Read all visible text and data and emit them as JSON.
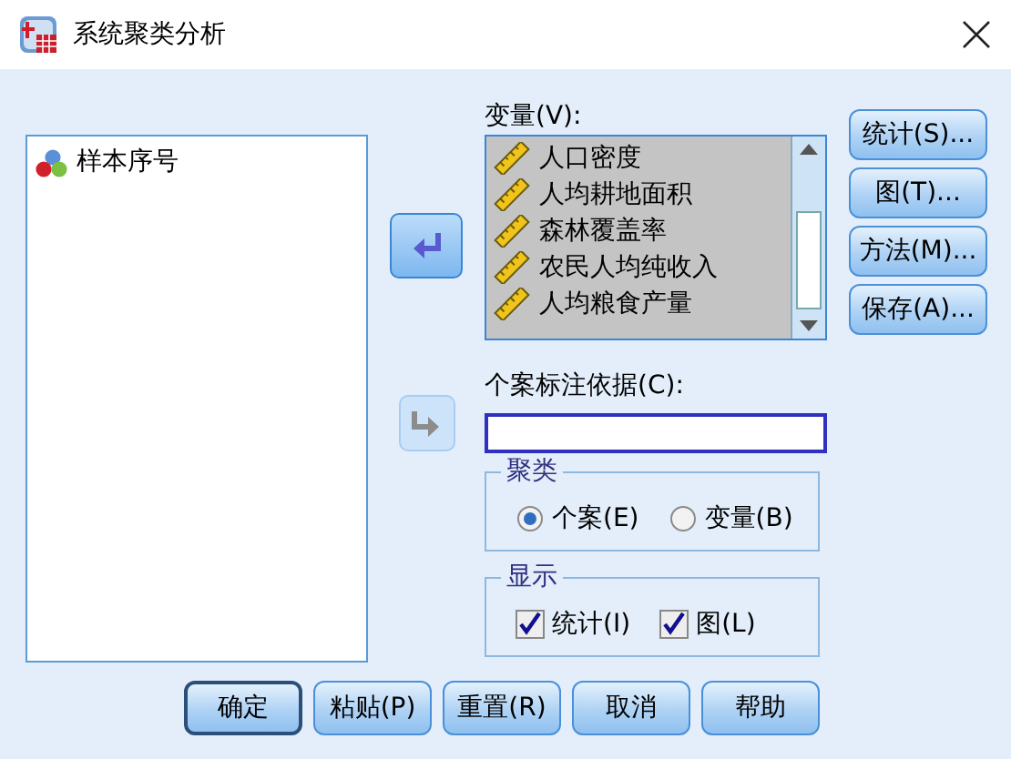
{
  "window": {
    "title": "系统聚类分析"
  },
  "source_list": {
    "items": [
      {
        "label": "样本序号",
        "selected": false
      }
    ]
  },
  "move_buttons": [
    {
      "kind": "left",
      "disabled": false
    },
    {
      "kind": "right",
      "disabled": true
    }
  ],
  "variables": {
    "label": "变量(V):",
    "items": [
      {
        "label": "人口密度",
        "selected": true
      },
      {
        "label": "人均耕地面积",
        "selected": true
      },
      {
        "label": "森林覆盖率",
        "selected": true
      },
      {
        "label": "农民人均纯收入",
        "selected": true
      },
      {
        "label": "人均粮食产量",
        "selected": true
      }
    ]
  },
  "case_label": {
    "label": "个案标注依据(C):"
  },
  "cluster": {
    "title": "聚类",
    "options": [
      {
        "label": "个案(E)",
        "selected": true
      },
      {
        "label": "变量(B)",
        "selected": false
      }
    ]
  },
  "display": {
    "title": "显示",
    "options": [
      {
        "label": "统计(I)",
        "checked": true
      },
      {
        "label": "图(L)",
        "checked": true
      }
    ]
  },
  "side_buttons": [
    "统计(S)...",
    "图(T)...",
    "方法(M)...",
    "保存(A)..."
  ],
  "buttons": [
    {
      "label": "确定",
      "default": true
    },
    {
      "label": "粘贴(P)",
      "default": false
    },
    {
      "label": "重置(R)",
      "default": false
    },
    {
      "label": "取消",
      "default": false
    },
    {
      "label": "帮助",
      "default": false
    }
  ]
}
